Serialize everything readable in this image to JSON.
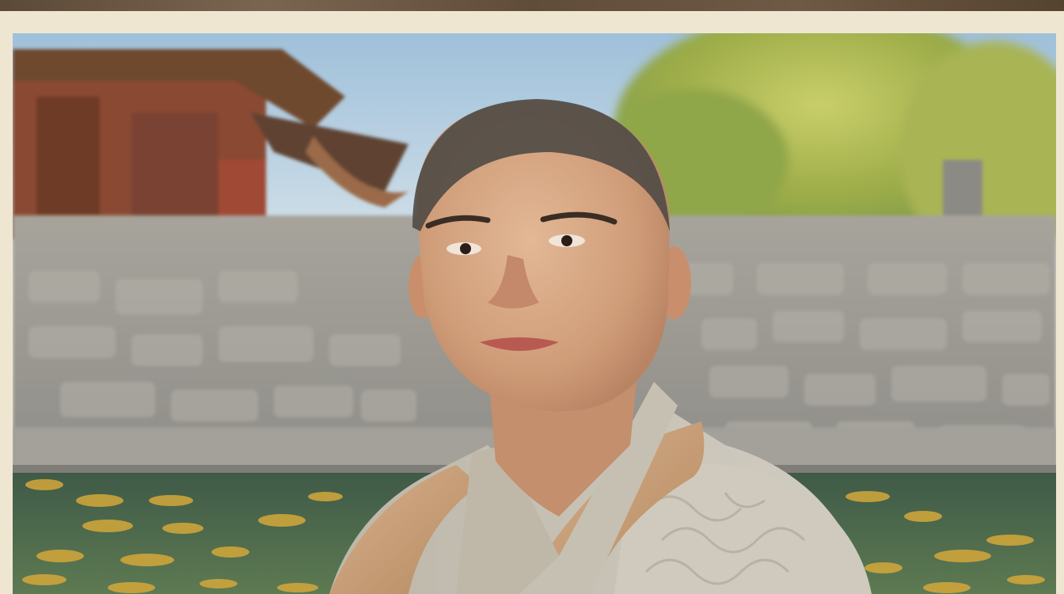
{
  "captions": [
    "",
    "",
    "",
    ""
  ],
  "photo": {
    "subject": "smiling-man-in-robes",
    "background": "temple-stone-wall",
    "colors": {
      "frame": "#efe6d2",
      "sky": "#a8c7de",
      "foliage": "#b9c15e",
      "stone": "#9a9892",
      "water": "#4f6a52",
      "robe_outer": "#c9a27a",
      "robe_inner": "#c2bdb0",
      "skin": "#d6a582"
    }
  }
}
